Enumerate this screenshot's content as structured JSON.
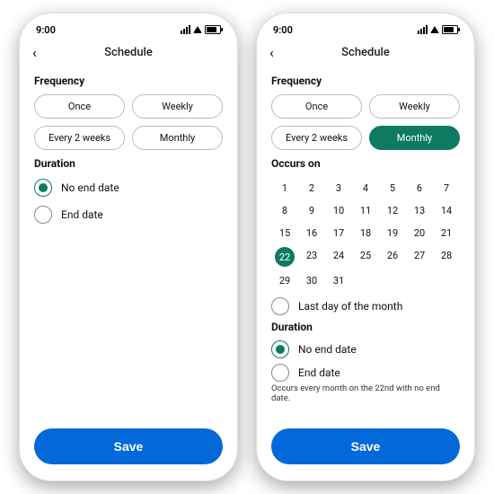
{
  "status": {
    "time": "9:00"
  },
  "nav": {
    "title": "Schedule"
  },
  "freq": {
    "label": "Frequency",
    "once": "Once",
    "weekly": "Weekly",
    "every2": "Every 2 weeks",
    "monthly": "Monthly"
  },
  "occurs": {
    "label": "Occurs on",
    "last_day": "Last day of the month",
    "selected": 22
  },
  "duration": {
    "label": "Duration",
    "no_end": "No end date",
    "end": "End date"
  },
  "summary": "Occurs every month on the 22nd with no end date.",
  "save": "Save",
  "days": [
    "1",
    "2",
    "3",
    "4",
    "5",
    "6",
    "7",
    "8",
    "9",
    "10",
    "11",
    "12",
    "13",
    "14",
    "15",
    "16",
    "17",
    "18",
    "19",
    "20",
    "21",
    "22",
    "23",
    "24",
    "25",
    "26",
    "27",
    "28",
    "29",
    "30",
    "31"
  ],
  "colors": {
    "accent": "#0d7a61",
    "primary": "#0368d9"
  }
}
